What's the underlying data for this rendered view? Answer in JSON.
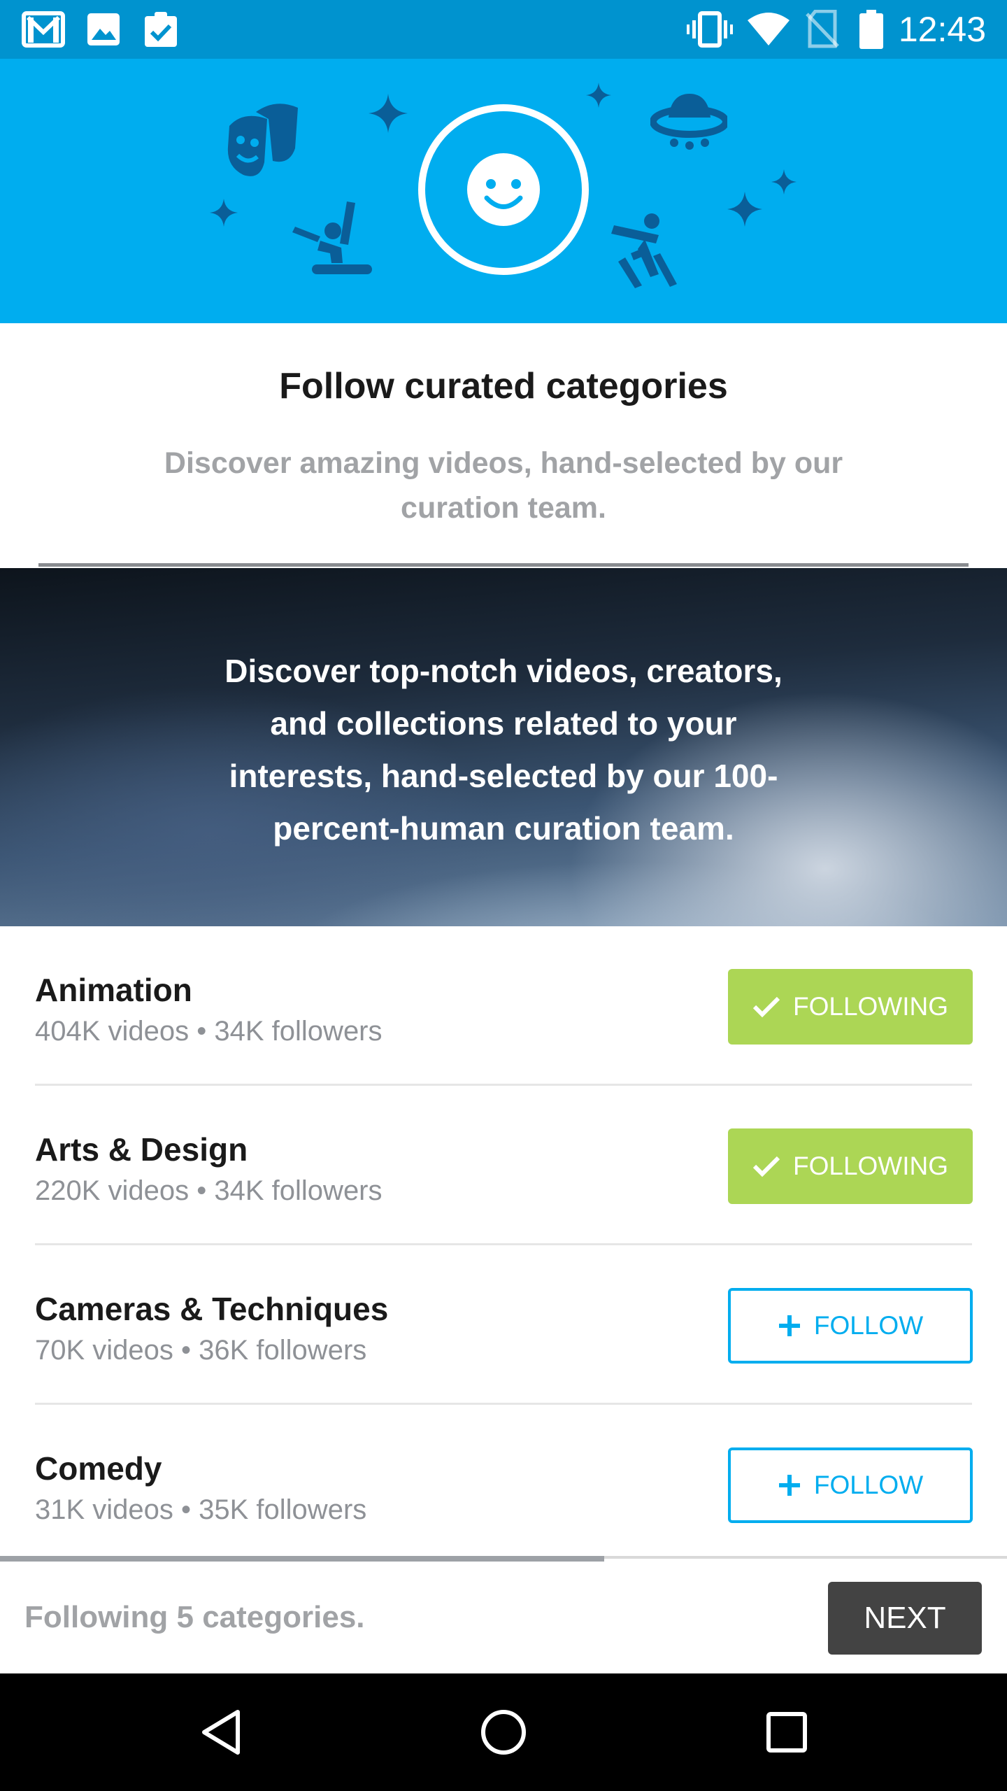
{
  "status_bar": {
    "time": "12:43",
    "left_icons": [
      "gmail-icon",
      "image-icon",
      "clipboard-check-icon"
    ],
    "right_icons": [
      "vibrate-icon",
      "wifi-icon",
      "no-sim-icon",
      "battery-icon"
    ]
  },
  "hero": {
    "avatar_icon": "smiley-face-icon",
    "decorations": [
      "theater-masks-icon",
      "ufo-icon",
      "snowboarder-icon",
      "skier-icon",
      "sparkle-icon"
    ]
  },
  "intro": {
    "title": "Follow curated categories",
    "subtitle": "Discover amazing videos, hand-selected by our curation team."
  },
  "banner": {
    "text": "Discover top-notch videos, creators, and collections related to your interests, hand-selected by our 100-percent-human curation team."
  },
  "categories": [
    {
      "name": "Animation",
      "meta": "404K videos • 34K followers",
      "button": "FOLLOWING",
      "state": "following"
    },
    {
      "name": "Arts & Design",
      "meta": "220K videos • 34K followers",
      "button": "FOLLOWING",
      "state": "following"
    },
    {
      "name": "Cameras & Techniques",
      "meta": "70K videos • 36K followers",
      "button": "FOLLOW",
      "state": "follow"
    },
    {
      "name": "Comedy",
      "meta": "31K videos • 35K followers",
      "button": "FOLLOW",
      "state": "follow"
    }
  ],
  "footer": {
    "status": "Following 5 categories.",
    "next_label": "NEXT",
    "scroll_progress": 0.6
  },
  "nav": {
    "buttons": [
      "back-icon",
      "home-icon",
      "recents-icon"
    ]
  },
  "colors": {
    "brand_blue": "#00adef",
    "status_bar": "#0093cf",
    "following_green": "#acd655",
    "next_button": "#434343"
  }
}
